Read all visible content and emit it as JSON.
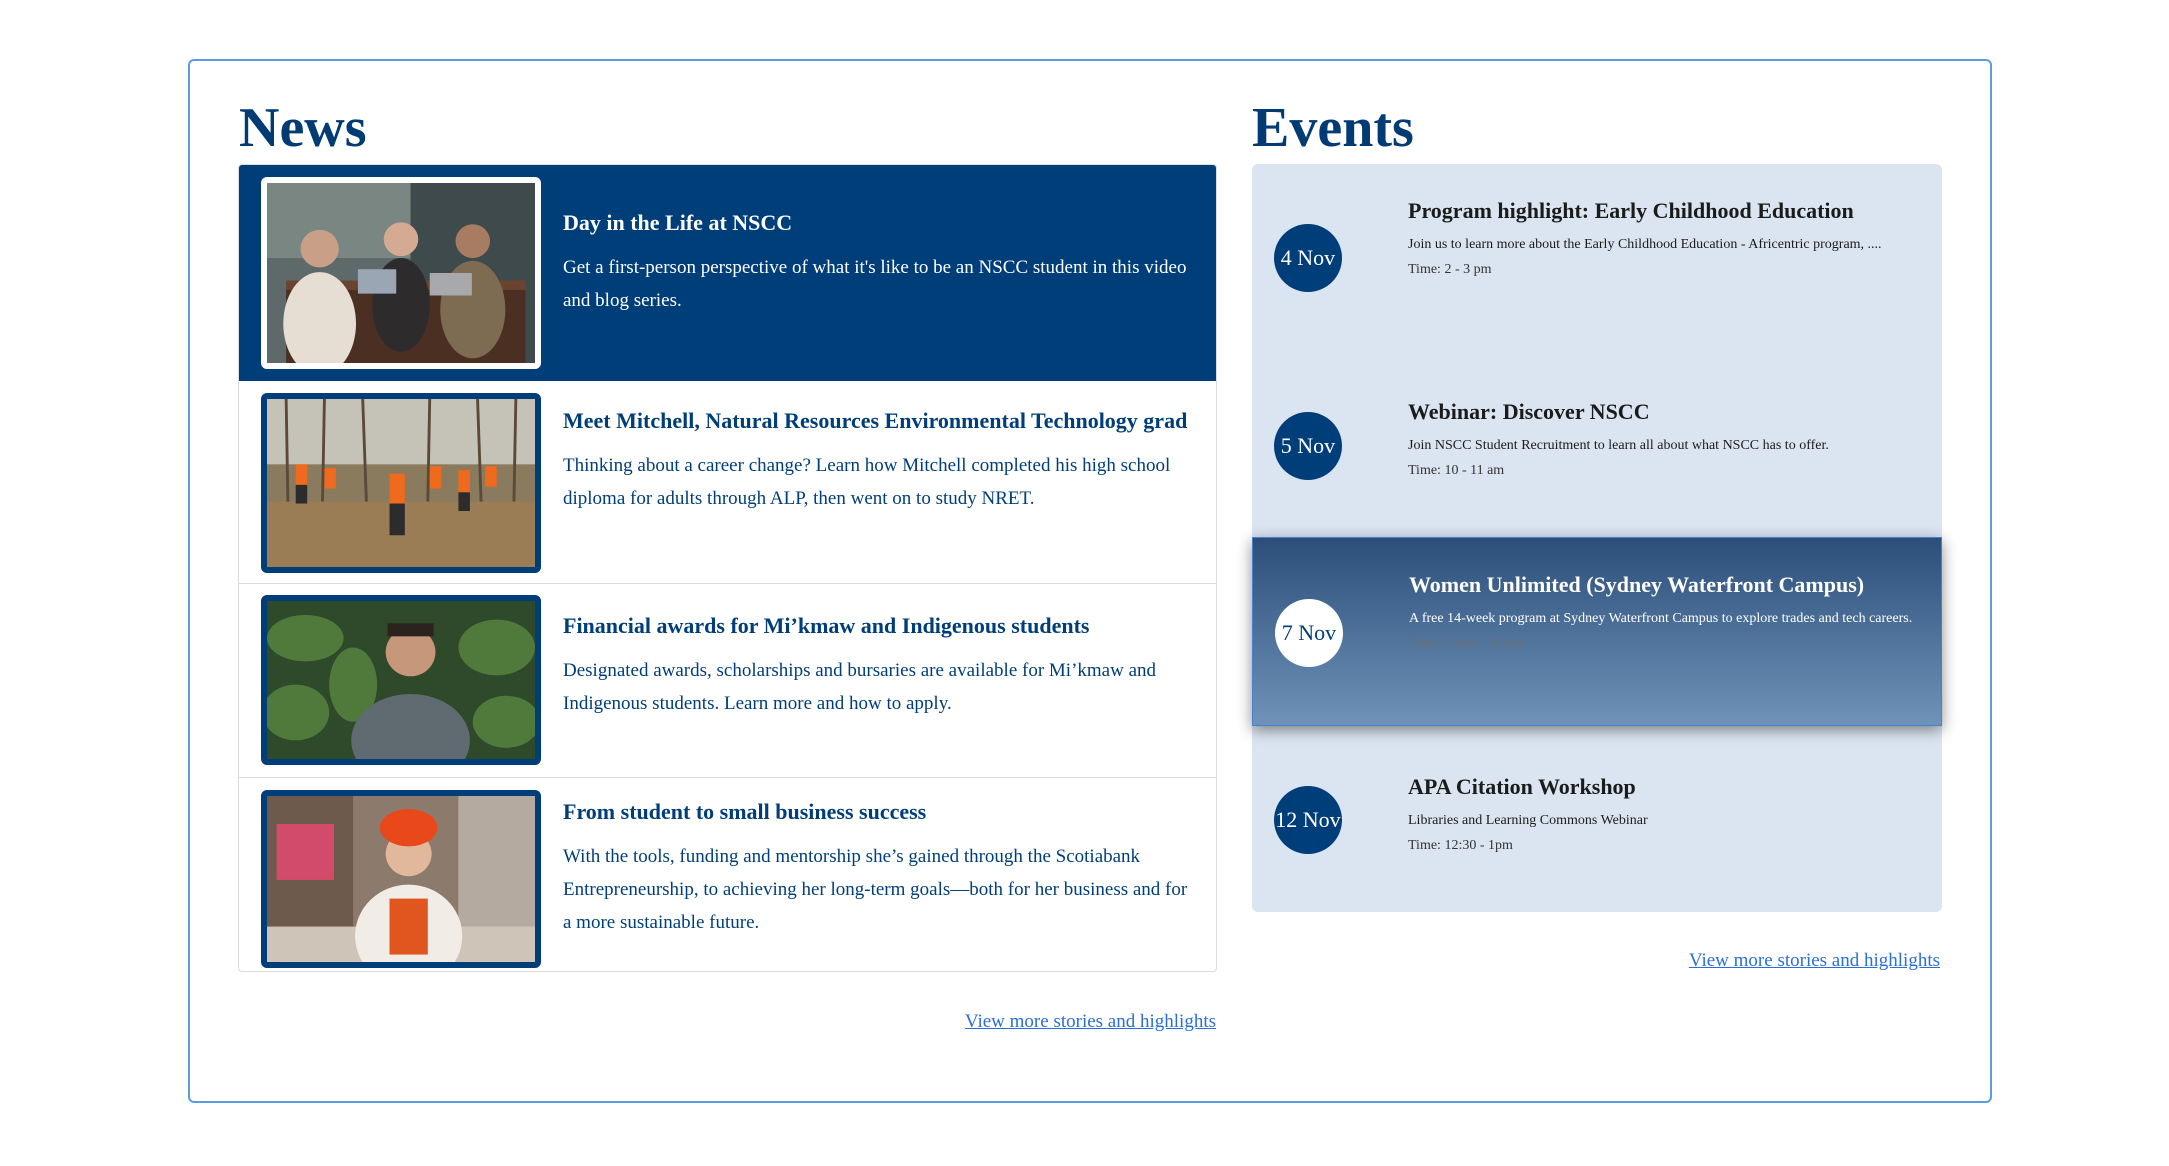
{
  "news": {
    "title": "News",
    "items": [
      {
        "heading": "Day in the Life at NSCC",
        "description": "Get a first-person perspective of what it's like to be an NSCC student in this video and blog series.",
        "image": "students-at-table-photo"
      },
      {
        "heading": "Meet Mitchell, Natural Resources Environmental Technology grad",
        "description": "Thinking about a career change? Learn how Mitchell completed his high school diploma for adults through ALP, then went on to study NRET.",
        "image": "students-in-forest-photo"
      },
      {
        "heading": "Financial awards for Mi’kmaw and Indigenous students",
        "description": "Designated awards, scholarships and bursaries are available for Mi’kmaw and Indigenous students. Learn more and how to apply.",
        "image": "student-portrait-photo"
      },
      {
        "heading": "From student to small business success",
        "description": "With the tools, funding and mentorship she’s gained through the Scotiabank Entrepreneurship, to achieving her long-term goals—both for her business and for a more sustainable future.",
        "image": "business-owner-photo"
      }
    ],
    "more_link": "View more stories and highlights"
  },
  "events": {
    "title": "Events",
    "items": [
      {
        "date": "4 Nov",
        "title": "Program highlight: Early Childhood Education",
        "description": "Join us to learn more about the Early Childhood Education - Africentric program, ....",
        "time": "Time: 2 - 3 pm"
      },
      {
        "date": "5 Nov",
        "title": "Webinar: Discover NSCC",
        "description": "Join NSCC Student Recruitment to learn all about what NSCC has to offer.",
        "time": "Time: 10 - 11 am"
      },
      {
        "date": "7 Nov",
        "title": "Women Unlimited (Sydney Waterfront Campus)",
        "description": "A free 14-week program at Sydney Waterfront Campus to explore trades and tech careers.",
        "time": "Time: 10am - 11 am"
      },
      {
        "date": "12 Nov",
        "title": "APA Citation Workshop",
        "description": "Libraries and Learning Commons Webinar",
        "time": "Time: 12:30 - 1pm"
      }
    ],
    "more_link": "View more stories and highlights"
  },
  "colors": {
    "primary": "#003e7a",
    "event_panel": "#dbe5f1",
    "link": "#2a6ed8",
    "frame_border": "#5b9bdf"
  }
}
